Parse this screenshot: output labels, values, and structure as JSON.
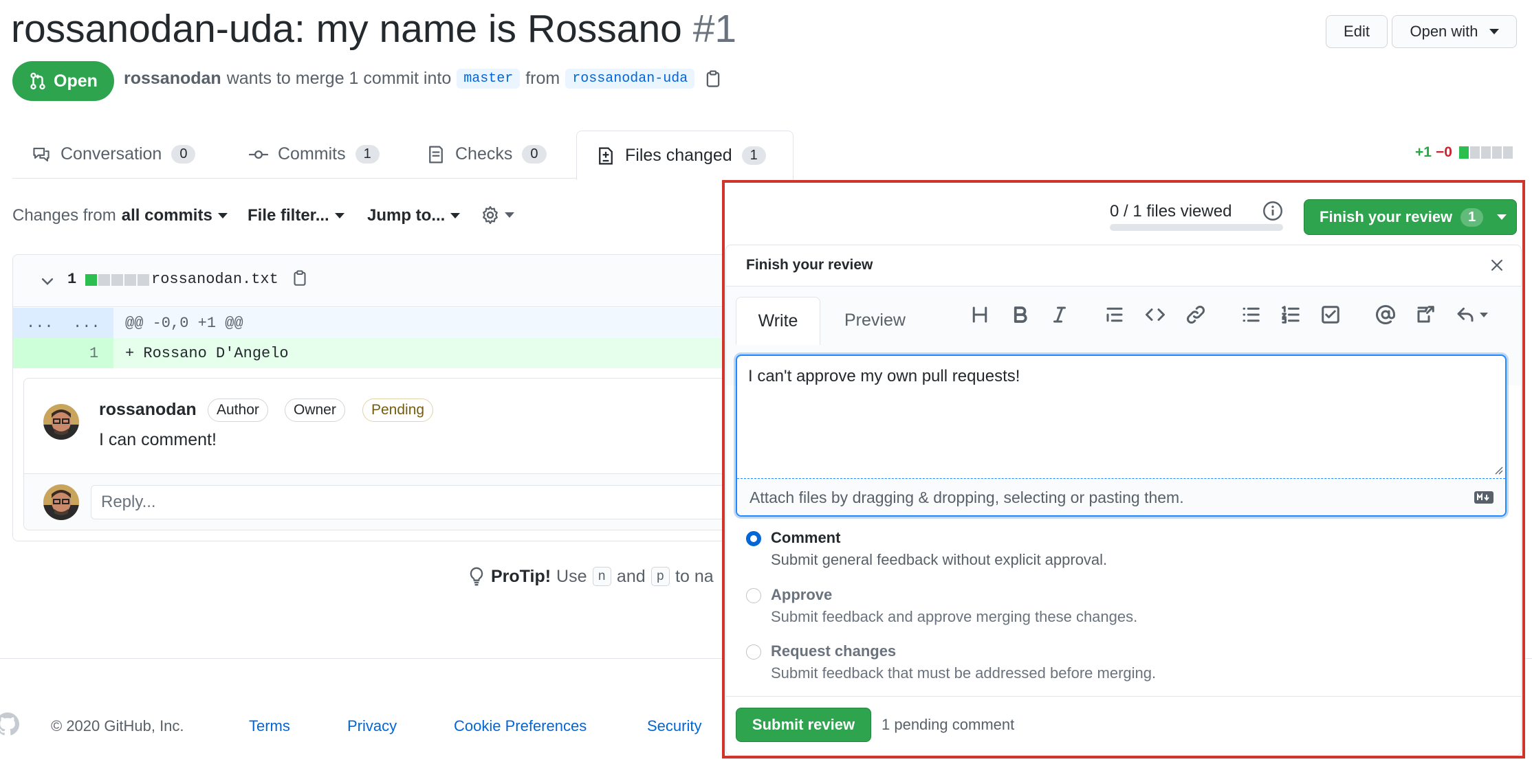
{
  "pr": {
    "title": "rossanodan-uda: my name is Rossano",
    "number": "#1",
    "state": "Open",
    "author": "rossanodan",
    "merge_text_1": "wants to merge 1 commit into",
    "base_branch": "master",
    "merge_text_2": "from",
    "head_branch": "rossanodan-uda"
  },
  "header_actions": {
    "edit": "Edit",
    "open_with": "Open with"
  },
  "tabs": [
    {
      "label": "Conversation",
      "count": "0",
      "icon": "comment-icon"
    },
    {
      "label": "Commits",
      "count": "1",
      "icon": "commit-icon"
    },
    {
      "label": "Checks",
      "count": "0",
      "icon": "checklist-icon"
    },
    {
      "label": "Files changed",
      "count": "1",
      "icon": "file-diff-icon"
    }
  ],
  "diffstat": {
    "added": "+1",
    "removed": "−0"
  },
  "toolbar": {
    "changes_from_prefix": "Changes from",
    "changes_from_value": "all commits",
    "file_filter": "File filter...",
    "jump_to": "Jump to..."
  },
  "file": {
    "changes": "1",
    "name": "rossanodan.txt",
    "hunk_left": "...",
    "hunk_right": "...",
    "hunk_header": "@@ -0,0 +1 @@",
    "line_number": "1",
    "line_content": "+ Rossano D'Angelo"
  },
  "comment": {
    "author": "rossanodan",
    "badges": [
      "Author",
      "Owner",
      "Pending"
    ],
    "body": "I can comment!",
    "reply_placeholder": "Reply..."
  },
  "protip": {
    "label": "ProTip!",
    "text_1": "Use",
    "key_n": "n",
    "text_2": "and",
    "key_p": "p",
    "text_3": "to na"
  },
  "review_bar": {
    "files_viewed": "0 / 1 files viewed",
    "files_viewed_progress": 0,
    "finish_button": "Finish your review",
    "finish_count": "1"
  },
  "review_panel": {
    "title": "Finish your review",
    "tab_write": "Write",
    "tab_preview": "Preview",
    "textarea_value": "I can't approve my own pull requests!",
    "attach_text": "Attach files by dragging & dropping, selecting or pasting them.",
    "options": [
      {
        "label": "Comment",
        "desc": "Submit general feedback without explicit approval.",
        "selected": true
      },
      {
        "label": "Approve",
        "desc": "Submit feedback and approve merging these changes.",
        "selected": false
      },
      {
        "label": "Request changes",
        "desc": "Submit feedback that must be addressed before merging.",
        "selected": false
      }
    ],
    "submit": "Submit review",
    "pending": "1 pending comment"
  },
  "footer": {
    "copyright": "© 2020 GitHub, Inc.",
    "links": [
      "Terms",
      "Privacy",
      "Cookie Preferences",
      "Security"
    ]
  },
  "colors": {
    "green": "#2ea44f",
    "open_badge": "#2ea44f",
    "link": "#0366d6",
    "highlight_border": "#d0352c",
    "pending_text": "#735c0f"
  }
}
